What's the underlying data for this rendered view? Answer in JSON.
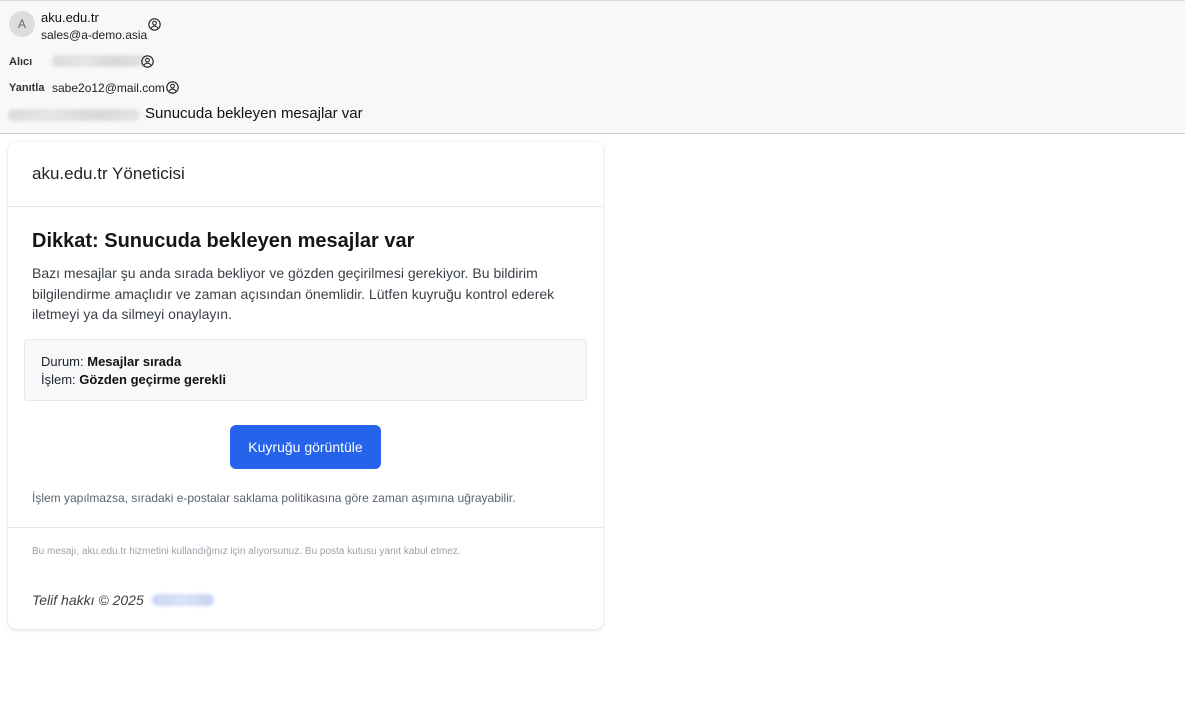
{
  "header": {
    "avatar_letter": "A",
    "sender_name": "aku.edu.tr",
    "sender_email": "sales@a-demo.asia",
    "to_label": "Alıcı",
    "reply_label": "Yanıtla",
    "reply_value": "sabe2o12@mail.com",
    "subject": "Sunucuda bekleyen mesajlar var",
    "icons": [
      "person-icon"
    ]
  },
  "email": {
    "brand": "aku.edu.tr Yöneticisi",
    "headline": "Dikkat: Sunucuda bekleyen mesajlar var",
    "body": "Bazı mesajlar şu anda sırada bekliyor ve gözden geçirilmesi gerekiyor. Bu bildirim bilgilendirme amaçlıdır ve zaman açısından önemlidir. Lütfen kuyruğu kontrol ederek iletmeyi ya da silmeyi onaylayın.",
    "status": {
      "state_label": "Durum:",
      "state_value": "Mesajlar sırada",
      "action_label": "İşlem:",
      "action_value": "Gözden geçirme gerekli"
    },
    "button_label": "Kuyruğu görüntüle",
    "note": "İşlem yapılmazsa, sıradaki e-postalar saklama politikasına göre zaman aşımına uğrayabilir.",
    "footer_note": "Bu mesajı, aku.edu.tr hizmetini kullandığınız için alıyorsunuz. Bu posta kutusu yanıt kabul etmez.",
    "copyright": "Telif hakkı © 2025"
  },
  "colors": {
    "button": "#2563eb",
    "header_bg": "#f8f8f8"
  }
}
